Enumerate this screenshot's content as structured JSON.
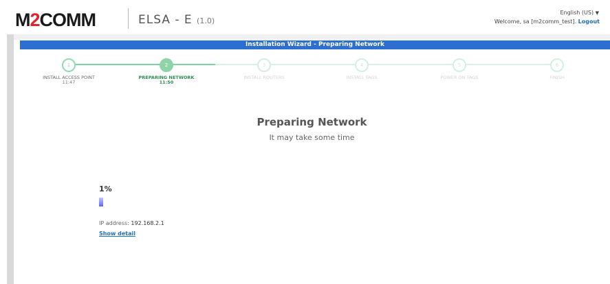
{
  "header": {
    "logo_prefix": "M",
    "logo_accent": "2",
    "logo_suffix": "COMM",
    "app_name": "ELSA - E",
    "app_version": "(1.0)",
    "language": "English (US)",
    "welcome_text": "Welcome, sa [m2comm_test].",
    "logout_label": "Logout"
  },
  "wizard": {
    "title": "Installation Wizard - Preparing Network",
    "steps": [
      {
        "number": "1",
        "label": "INSTALL ACCESS POINT",
        "time": "11:47",
        "state": "done"
      },
      {
        "number": "2",
        "label": "PREPARING NETWORK",
        "time": "11:50",
        "state": "active"
      },
      {
        "number": "3",
        "label": "INSTALL ROUTERS",
        "time": "",
        "state": "future"
      },
      {
        "number": "4",
        "label": "INSTALL TAGS",
        "time": "",
        "state": "future"
      },
      {
        "number": "5",
        "label": "POWER ON TAGS",
        "time": "",
        "state": "future"
      },
      {
        "number": "6",
        "label": "FINISH",
        "time": "",
        "state": "future"
      }
    ]
  },
  "main": {
    "heading": "Preparing Network",
    "subheading": "It may take some time",
    "progress_text": "1%",
    "progress_fraction": 0.01,
    "ip_label": "IP address:",
    "ip_value": "192.168.2.1",
    "show_detail_label": "Show detail"
  },
  "colors": {
    "title_bar": "#2c6fd0",
    "brand_accent": "#e0232e",
    "step_green": "#8fd3a8",
    "active_text": "#2e8b50",
    "link": "#1f6fbf",
    "progress_fill": "#6166f5"
  }
}
